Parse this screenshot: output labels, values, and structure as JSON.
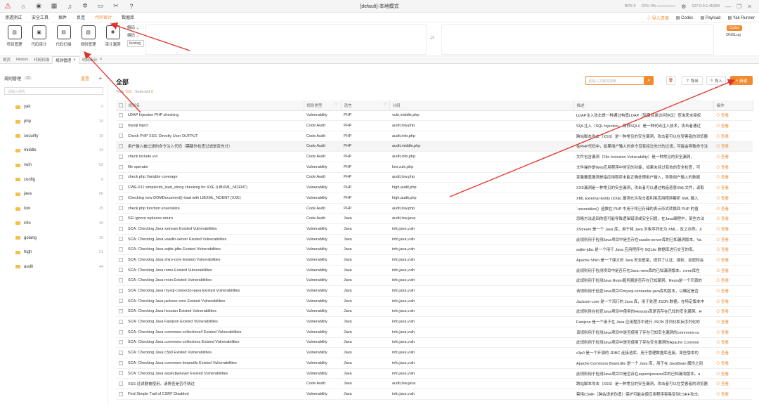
{
  "window": {
    "title": "[default]-本地模式",
    "rps": "RPS 0",
    "cpu": "CPU 0%",
    "ip": "127.0.0.1:45384"
  },
  "menu": {
    "items": [
      "渗透测试",
      "安全工具",
      "插件",
      "反连",
      "代码审计",
      "数据库"
    ],
    "active_index": 4,
    "right": {
      "import": "导入资源",
      "codec": "Codec",
      "payload": "Payload",
      "runner": "Yak Runner"
    }
  },
  "toolbar": {
    "tools": [
      {
        "label": "项目管理",
        "icon": "project-icon"
      },
      {
        "label": "代码审计",
        "icon": "audit-icon"
      },
      {
        "label": "代码扫描",
        "icon": "scan-icon"
      },
      {
        "label": "规则管理",
        "icon": "rules-icon"
      },
      {
        "label": "审计漏洞",
        "icon": "bug-icon"
      }
    ],
    "decode": "解码",
    "encode": "编码",
    "fuzztag": "fuzztag",
    "codec_tag": "Codec",
    "dnslog": "DNSLog"
  },
  "tabs": [
    {
      "label": "首页",
      "closable": false
    },
    {
      "label": "History",
      "closable": false
    },
    {
      "label": "代码扫描",
      "closable": false
    },
    {
      "label": "规则管理",
      "closable": true,
      "active": true
    },
    {
      "label": "代码审计",
      "closable": true
    }
  ],
  "sidebar": {
    "title": "规则管理",
    "count": "12",
    "reset": "重置",
    "search_placeholder": "请输入组名",
    "groups": [
      {
        "name": "yak",
        "count": "0"
      },
      {
        "name": "php",
        "count": "10"
      },
      {
        "name": "security",
        "count": "10"
      },
      {
        "name": "middle",
        "count": "14"
      },
      {
        "name": "vuln",
        "count": "52"
      },
      {
        "name": "config",
        "count": "6"
      },
      {
        "name": "java",
        "count": "86"
      },
      {
        "name": "low",
        "count": "25"
      },
      {
        "name": "info",
        "count": "49"
      },
      {
        "name": "golang",
        "count": "16"
      },
      {
        "name": "high",
        "count": "21"
      },
      {
        "name": "audit",
        "count": "44"
      }
    ]
  },
  "main": {
    "title": "全部",
    "total_label": "Total",
    "total": "105",
    "selected_label": "Selected",
    "selected": "0",
    "search_placeholder": "请输入关键词搜索",
    "export": "导出",
    "import": "导入",
    "new": "新建",
    "columns": [
      "规则名",
      "规则类型",
      "语言",
      "分组",
      "描述",
      "操作"
    ],
    "view": "查看",
    "rows": [
      [
        "LDAP Injection PHP checking",
        "Vulnerability",
        "PHP",
        "vuln,middle,php",
        "LDAP注入攻击是一种通过构造LDAP（轻量目录访问协议）查询来未授权"
      ],
      [
        "mysql inject",
        "Code Audit",
        "PHP",
        "audit,low,php",
        "SQL注入（SQL Injection，简称SQLi）是一种代码注入技术，攻击者通过"
      ],
      [
        "Check PHP XSS: Directly User OUTPUT",
        "Code Audit",
        "PHP",
        "audit,info,php",
        "跨站脚本攻击（XSS）是一种常见的安全漏洞，攻击者可以在受害者的浏览器"
      ],
      [
        "用户输入被过滤的命令注入代码（需额外检查过滤是否充分）",
        "Code Audit",
        "PHP",
        "audit,middle,php",
        "在PHP代码中，如果用户输入的命令没有经过充分的过滤，可能会导致命令注"
      ],
      [
        "check include vul",
        "Code Audit",
        "PHP",
        "audit,info,php",
        "文件包含漏洞（File Inclusion Vulnerability）是一种常见的安全漏洞，"
      ],
      [
        "file operator",
        "Vulnerability",
        "PHP",
        "low,vuln,php",
        "文件操作是Web应用程序中常见的功能，如果未经过有效的安全检查，可"
      ],
      [
        "check php Variable coverage",
        "Code Audit",
        "PHP",
        "audit,low,php",
        "变量覆盖漏洞是指应用程序未能正确处理用户输入，导致用户输入的数据"
      ],
      [
        "CWE-611 simplexml_load_string checking for XXE (LIBXML_NOENT)",
        "Vulnerability",
        "PHP",
        "high,audit,php",
        "XXE漏洞是一种常见的安全漏洞，攻击者可以通过构造恶意XML文件，读取"
      ],
      [
        "Checking new DOMDocument()-load with LIBXML_NOENT (XXE)",
        "Vulnerability",
        "PHP",
        "high,audit,php",
        "XML External Entity (XXE) 漏洞允许攻击者利用应用程序解析 XML 输入"
      ],
      [
        "check php function unserialize",
        "Code Audit",
        "PHP",
        "audit,low,php",
        "`unserialize()` 函数在 PHP 中用于将已存储的表示形式转换回 PHP 的值"
      ],
      [
        "SEI ignore replaces return",
        "Code Audit",
        "Java",
        "audit,low,java",
        "忽略方法返回的值可能导致逻辑错误或安全问题，在Java编程中，某些方法"
      ],
      [
        "SCA: Checking Java xstream Existed Vulnerabilities",
        "Vulnerability",
        "Java",
        "info,java,vuln",
        "XStream 是一个 Java 库，用于将 Java 对象序列化为 XML，反之亦然。X"
      ],
      [
        "SCA: Checking Java vaadin-server Existed Vulnerabilities",
        "Vulnerability",
        "Java",
        "info,java,vuln",
        "此规则用于检测Java项目中是否存在vaadin-server库的已知漏洞版本。Va"
      ],
      [
        "SCA: Checking Java sqlite-jdbc Existed Vulnerabilities",
        "Vulnerability",
        "Java",
        "info,java,vuln",
        "sqlite-jdbc 是一个用于 Java 应用程序与 SQLite 数据库进行交互的库。"
      ],
      [
        "SCA: Checking Java shiro-core Existed Vulnerabilities",
        "Vulnerability",
        "Java",
        "info,java,vuln",
        "Apache Shiro 是一个强大的 Java 安全框架，提供了认证、授权、加密和会"
      ],
      [
        "SCA: Checking Java rome Existed Vulnerabilities",
        "Vulnerability",
        "Java",
        "info,java,vuln",
        "此规则用于检测项目中是否存在Java rome库的已知漏洞版本。rome库在"
      ],
      [
        "SCA: Checking Java resin Existed Vulnerabilities",
        "Vulnerability",
        "Java",
        "info,java,vuln",
        "此规则用于检测Java Resin服务器是否存在已知漏洞。Resin是一个开源的"
      ],
      [
        "SCA: Checking Java mysql-connector-java Existed Vulnerabilities",
        "Vulnerability",
        "Java",
        "info,java,vuln",
        "该规则用于检查Java项目中mysql-connector-java库的版本，以确定是否"
      ],
      [
        "SCA: Checking Java jackson-core Existed Vulnerabilities",
        "Vulnerability",
        "Java",
        "info,java,vuln",
        "Jackson-core 是一个流行的 Java 库，用于处理 JSON 数据。在特定版本中"
      ],
      [
        "SCA: Checking Java hessian Existed Vulnerabilities",
        "Vulnerability",
        "Java",
        "info,java,vuln",
        "此规则旨在检查Java项目中使用的Hessian库是否存在已知的安全漏洞。H"
      ],
      [
        "SCA: Checking Java Fastjson Existed Vulnerabilities",
        "Vulnerability",
        "Java",
        "info,java,vuln",
        "Fastjson 是一个用于在 Java 应用程序中进行 JSON 序列化和反序列化的"
      ],
      [
        "SCA: Checking Java commons-collections4 Existed Vulnerabilities",
        "Vulnerability",
        "Java",
        "info,java,vuln",
        "该规则用于检测Java项目中是否使用了存在已知安全漏洞的commons-co"
      ],
      [
        "SCA: Checking Java commons-collections Existed Vulnerabilities",
        "Vulnerability",
        "Java",
        "info,java,vuln",
        "此规则用于检测Java项目中是否使用了存在安全漏洞的Apache Common"
      ],
      [
        "SCA: Checking Java c3p0 Existed Vulnerabilities",
        "Vulnerability",
        "Java",
        "info,java,vuln",
        "c3p0 是一个开源的 JDBC 连接池库，用于管理数据库连接。某些版本的"
      ],
      [
        "SCA: Checking Java commons-beanutils Existed Vulnerabilities",
        "Vulnerability",
        "Java",
        "info,java,vuln",
        "Apache Commons BeanUtils 是一个 Java 库，用于在 JavaBean 属性之间"
      ],
      [
        "SCA: Checking Java aspectjweaver Existed Vulnerabilities",
        "Vulnerability",
        "Java",
        "info,java,vuln",
        "此规则用于检测Java项目中是否存在aspectjweaver库的已知漏洞版本。a"
      ],
      [
        "XSS 过滤器被使用，请排查是否可绕过",
        "Code Audit",
        "Java",
        "audit,low,java",
        "跨站脚本攻击（XSS）是一种常见的安全漏洞，攻击者可以在受害者的浏览器"
      ],
      [
        "Find Simple Trail of CSRF Disabled",
        "Vulnerability",
        "Java",
        "info,java,vuln",
        "禁用CSRF（跨站请求伪造）保护可能会使应用程序容易受到CSRF攻击。"
      ]
    ]
  }
}
